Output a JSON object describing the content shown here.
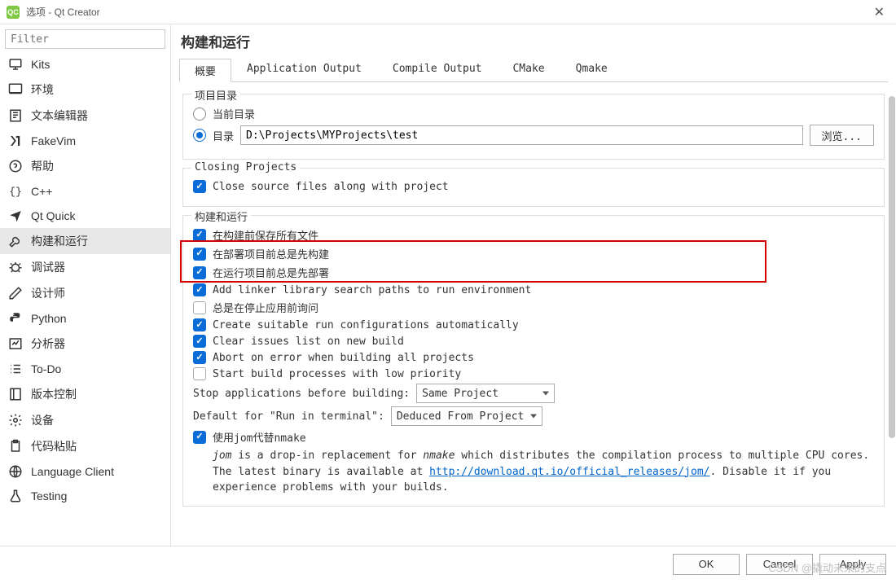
{
  "window": {
    "title": "选项 - Qt Creator",
    "icon_text": "QC"
  },
  "filter": {
    "placeholder": "Filter"
  },
  "categories": [
    {
      "id": "kits",
      "label": "Kits"
    },
    {
      "id": "env",
      "label": "环境"
    },
    {
      "id": "text",
      "label": "文本编辑器"
    },
    {
      "id": "fakevim",
      "label": "FakeVim"
    },
    {
      "id": "help",
      "label": "帮助"
    },
    {
      "id": "cpp",
      "label": "C++"
    },
    {
      "id": "qtquick",
      "label": "Qt Quick"
    },
    {
      "id": "build",
      "label": "构建和运行"
    },
    {
      "id": "debug",
      "label": "调试器"
    },
    {
      "id": "design",
      "label": "设计师"
    },
    {
      "id": "python",
      "label": "Python"
    },
    {
      "id": "analyzer",
      "label": "分析器"
    },
    {
      "id": "todo",
      "label": "To-Do"
    },
    {
      "id": "vcs",
      "label": "版本控制"
    },
    {
      "id": "devices",
      "label": "设备"
    },
    {
      "id": "paste",
      "label": "代码粘贴"
    },
    {
      "id": "lang",
      "label": "Language Client"
    },
    {
      "id": "testing",
      "label": "Testing"
    }
  ],
  "selected_category": "build",
  "page": {
    "title": "构建和运行",
    "tabs": [
      "概要",
      "Application Output",
      "Compile Output",
      "CMake",
      "Qmake"
    ],
    "active_tab": 0
  },
  "group_projdir": {
    "title": "项目目录",
    "opt_current": "当前目录",
    "opt_dir": "目录",
    "dir_value": "D:\\Projects\\MYProjects\\test",
    "browse": "浏览..."
  },
  "group_closing": {
    "title": "Closing Projects",
    "close_source": "Close source files along with project"
  },
  "group_build": {
    "title": "构建和运行",
    "save_all": "在构建前保存所有文件",
    "build_before_deploy": "在部署项目前总是先构建",
    "deploy_before_run": "在运行项目前总是先部署",
    "add_linker": "Add linker library search paths to run environment",
    "ask_stop": "总是在停止应用前询问",
    "create_run_cfg": "Create suitable run configurations automatically",
    "clear_issues": "Clear issues list on new build",
    "abort_error": "Abort on error when building all projects",
    "low_priority": "Start build processes with low priority",
    "stop_apps_label": "Stop applications before building:",
    "stop_apps_value": "Same Project",
    "terminal_label": "Default for \"Run in terminal\":",
    "terminal_value": "Deduced From Project",
    "use_jom": "使用jom代替nmake",
    "jom_note_1a": "jom",
    "jom_note_1b": " is a drop-in replacement for ",
    "jom_note_1c": "nmake",
    "jom_note_1d": " which distributes the compilation process to multiple CPU cores. The latest binary is available at ",
    "jom_link": "http://download.qt.io/official_releases/jom/",
    "jom_note_2": ". Disable it if you experience problems with your builds."
  },
  "footer": {
    "ok": "OK",
    "cancel": "Cancel",
    "apply": "Apply"
  },
  "watermark": "CSDN @撬动未来的支点"
}
